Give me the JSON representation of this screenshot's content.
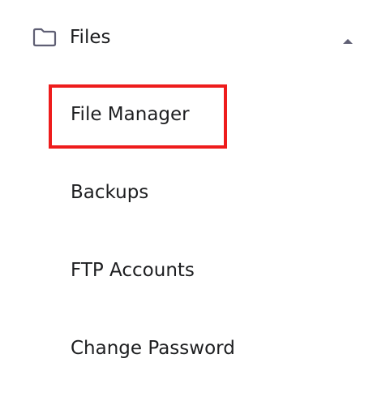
{
  "section": {
    "title": "Files",
    "icon": "folder-icon",
    "toggle_icon": "caret-up-icon",
    "icon_color": "#5f5f74"
  },
  "submenu": {
    "items": [
      {
        "label": "File Manager",
        "highlighted": true
      },
      {
        "label": "Backups",
        "highlighted": false
      },
      {
        "label": "FTP Accounts",
        "highlighted": false
      },
      {
        "label": "Change Password",
        "highlighted": false
      }
    ]
  },
  "colors": {
    "text": "#1d1e20",
    "highlight": "#ee1c1c",
    "background": "#ffffff"
  }
}
